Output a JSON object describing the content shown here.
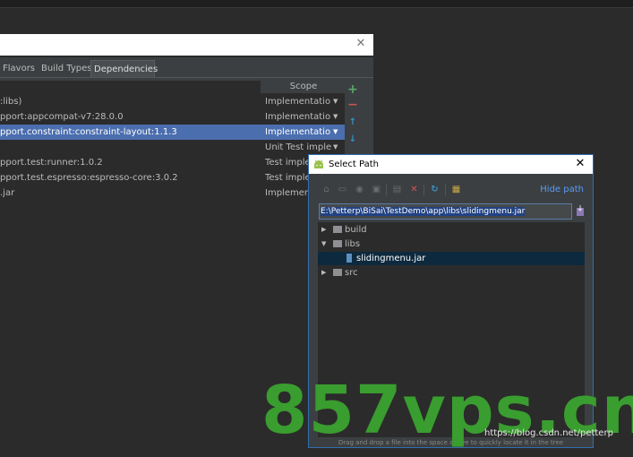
{
  "project_structure": {
    "tabs": [
      {
        "label": "Flavors"
      },
      {
        "label": "Build Types"
      },
      {
        "label": "Dependencies",
        "active": true
      }
    ],
    "scope_header": "Scope",
    "dependencies": [
      {
        "library": ":libs)",
        "scope": "Implementation",
        "dropdown": true,
        "selected": false
      },
      {
        "library": "pport:appcompat-v7:28.0.0",
        "scope": "Implementation",
        "dropdown": true,
        "selected": false
      },
      {
        "library": "pport.constraint:constraint-layout:1.1.3",
        "scope": "Implementation",
        "dropdown": true,
        "selected": true
      },
      {
        "library": "",
        "scope": "Unit Test implem...",
        "dropdown": true,
        "selected": false
      },
      {
        "library": "pport.test:runner:1.0.2",
        "scope": "Test implem",
        "dropdown": false,
        "selected": false
      },
      {
        "library": "pport.test.espresso:espresso-core:3.0.2",
        "scope": "Test implem",
        "dropdown": false,
        "selected": false
      },
      {
        "library": ".jar",
        "scope": "Implementa",
        "dropdown": false,
        "selected": false
      }
    ],
    "side_buttons": [
      {
        "icon": "plus-icon",
        "glyph": "+",
        "color": "#59a869"
      },
      {
        "icon": "minus-icon",
        "glyph": "−",
        "color": "#c75450"
      },
      {
        "icon": "arrow-up-icon",
        "glyph": "↑",
        "color": "#3592c4"
      },
      {
        "icon": "arrow-down-icon",
        "glyph": "↓",
        "color": "#3592c4"
      }
    ]
  },
  "select_path": {
    "title": "Select Path",
    "hide_path": "Hide path",
    "path_value": "E:\\Petterp\\BiSai\\TestDemo\\app\\libs\\slidingmenu.jar",
    "toolbar": [
      {
        "icon": "home-icon",
        "glyph": "⌂"
      },
      {
        "icon": "desktop-icon",
        "glyph": "▭"
      },
      {
        "icon": "android-module-icon",
        "glyph": "◉"
      },
      {
        "icon": "project-icon",
        "glyph": "▣"
      },
      {
        "icon": "new-folder-icon",
        "glyph": "▤"
      },
      {
        "icon": "delete-icon",
        "glyph": "✕"
      },
      {
        "icon": "refresh-icon",
        "glyph": "↻"
      },
      {
        "icon": "show-hidden-icon",
        "glyph": "▦"
      }
    ],
    "tree": [
      {
        "label": "build",
        "type": "folder",
        "expanded": false,
        "depth": 0
      },
      {
        "label": "libs",
        "type": "folder",
        "expanded": true,
        "depth": 0
      },
      {
        "label": "slidingmenu.jar",
        "type": "jar",
        "depth": 1,
        "selected": true
      },
      {
        "label": "src",
        "type": "folder",
        "expanded": false,
        "depth": 0
      }
    ],
    "hint": "Drag and drop a file into the space above to quickly locate it in the tree"
  },
  "watermark": "857vps.cn",
  "credit": "https://blog.csdn.net/petterp",
  "colors": {
    "selection_blue": "#4b6eaf",
    "tree_selection": "#0d293e",
    "link_blue": "#589df6",
    "watermark_green": "#3a9d2f"
  }
}
